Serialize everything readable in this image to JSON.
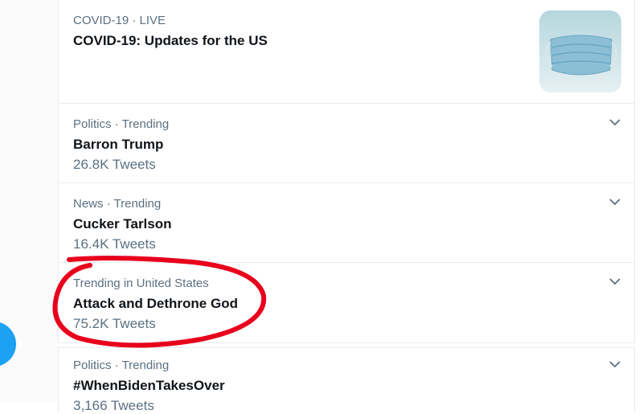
{
  "trends": [
    {
      "meta": "COVID-19 · LIVE",
      "title": "COVID-19: Updates for the US",
      "count": ""
    },
    {
      "meta": "Politics · Trending",
      "title": "Barron Trump",
      "count": "26.8K Tweets"
    },
    {
      "meta": "News · Trending",
      "title": "Cucker Tarlson",
      "count": "16.4K Tweets"
    },
    {
      "meta": "Trending in United States",
      "title": "Attack and Dethrone God",
      "count": "75.2K Tweets"
    },
    {
      "meta": "Politics · Trending",
      "title": "#WhenBidenTakesOver",
      "count": "3,166 Tweets"
    }
  ],
  "icons": {
    "more": "chevron-down-icon",
    "thumbnail": "face-mask-image",
    "compose": "compose-fab"
  },
  "colors": {
    "accent": "#1da1f2",
    "secondary_text": "#5b7083",
    "primary_text": "#0f1419",
    "annotation": "#e8001c"
  }
}
